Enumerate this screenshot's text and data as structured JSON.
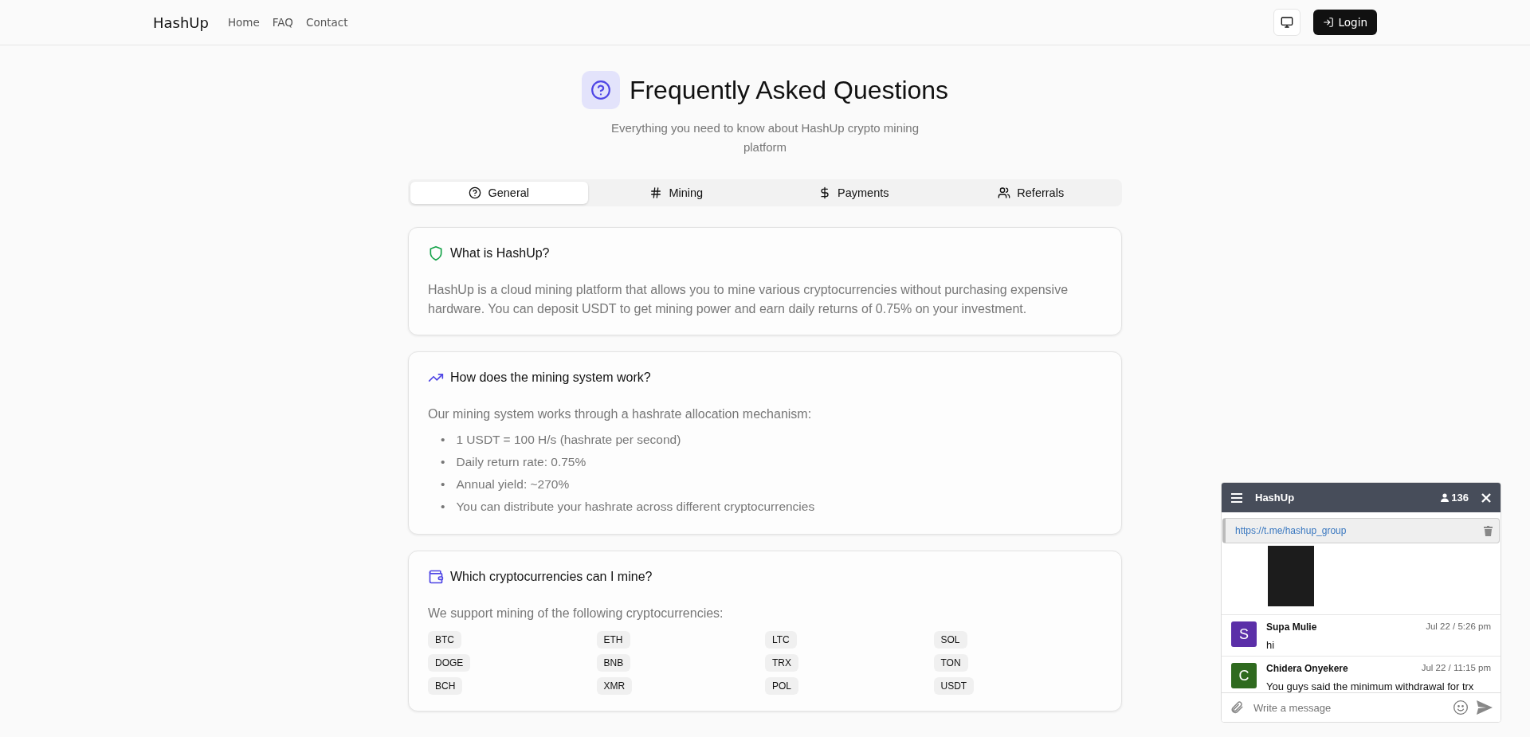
{
  "header": {
    "logo": "HashUp",
    "nav": [
      {
        "label": "Home"
      },
      {
        "label": "FAQ"
      },
      {
        "label": "Contact"
      }
    ],
    "login": "Login"
  },
  "hero": {
    "title": "Frequently Asked Questions",
    "subtitle": "Everything you need to know about HashUp crypto mining platform"
  },
  "tabs": [
    {
      "label": "General",
      "selected": true
    },
    {
      "label": "Mining",
      "selected": false
    },
    {
      "label": "Payments",
      "selected": false
    },
    {
      "label": "Referrals",
      "selected": false
    }
  ],
  "faqs": [
    {
      "question": "What is HashUp?",
      "color": "#16a34a",
      "answer": "HashUp is a cloud mining platform that allows you to mine various cryptocurrencies without purchasing expensive hardware. You can deposit USDT to get mining power and earn daily returns of 0.75% on your investment."
    },
    {
      "question": "How does the mining system work?",
      "color": "#4f46e5",
      "answer": "Our mining system works through a hashrate allocation mechanism:",
      "marker": "•",
      "bullets": [
        "1 USDT = 100 H/s (hashrate per second)",
        "Daily return rate: 0.75%",
        "Annual yield: ~270%",
        "You can distribute your hashrate across different cryptocurrencies"
      ]
    },
    {
      "question": "Which cryptocurrencies can I mine?",
      "color": "#4f46e5",
      "answer": "We support mining of the following cryptocurrencies:",
      "tags": [
        "BTC",
        "ETH",
        "LTC",
        "SOL",
        "DOGE",
        "BNB",
        "TRX",
        "TON",
        "BCH",
        "XMR",
        "POL",
        "USDT"
      ]
    }
  ],
  "chat": {
    "title": "HashUp",
    "members": "136",
    "pinned_link": "https://t.me/hashup_group",
    "messages": [
      {
        "initial": "S",
        "color": "#5b2fa8",
        "author": "Supa Mulie",
        "time": "Jul 22 / 5:26 pm",
        "text": "hi"
      },
      {
        "initial": "C",
        "color": "#2f6a1f",
        "author": "Chidera Onyekere",
        "time": "Jul 22 / 11:15 pm",
        "text": "You guys said the minimum withdrawal for trx"
      }
    ],
    "placeholder": "Write a message"
  }
}
